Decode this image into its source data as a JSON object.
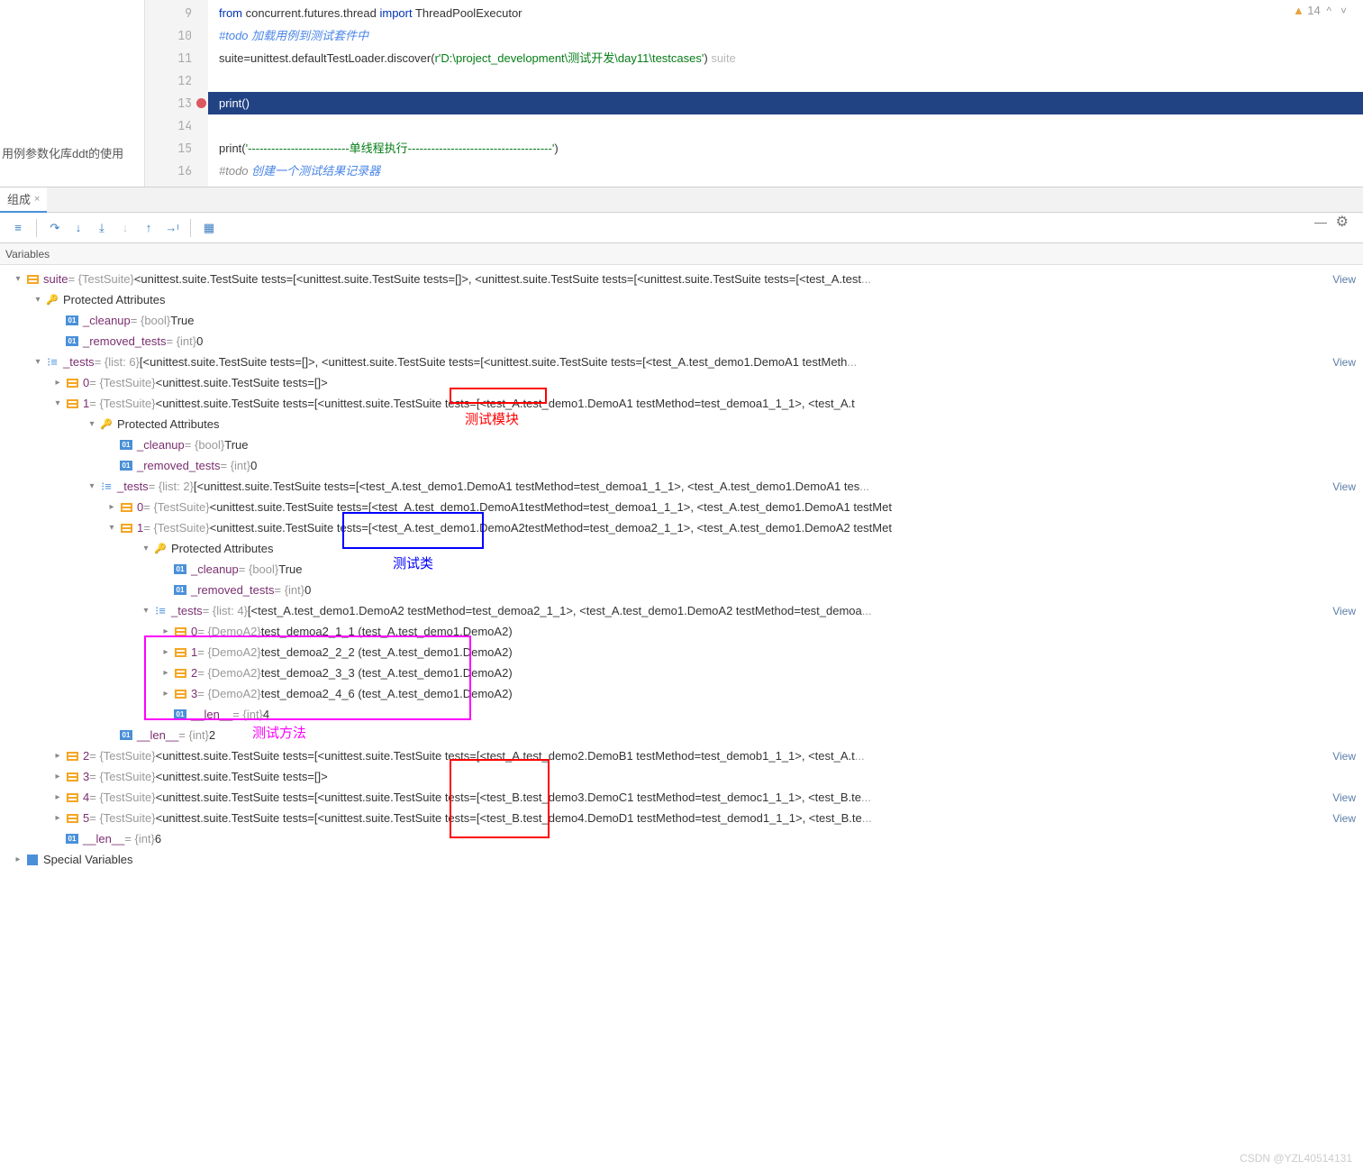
{
  "left_pane_text": "用例参数化库ddt的使用",
  "warn_count": "14",
  "lines": {
    "9": {
      "num": "9"
    },
    "10": {
      "num": "10"
    },
    "11": {
      "num": "11"
    },
    "12": {
      "num": "12"
    },
    "13": {
      "num": "13"
    },
    "14": {
      "num": "14"
    },
    "15": {
      "num": "15"
    },
    "16": {
      "num": "16"
    }
  },
  "code": {
    "l9_from": "from",
    "l9_mod": " concurrent.futures.thread ",
    "l9_import": "import",
    "l9_cls": " ThreadPoolExecutor",
    "l10": "#todo  加载用例到测试套件中",
    "l11_a": "suite=unittest.defaultTestLoader.discover(",
    "l11_b": "r'D:\\project_development\\测试开发\\day11\\testcases'",
    "l11_c": ")",
    "l11_d": "   suite",
    "l13": "print()",
    "l15_a": "print(",
    "l15_b": "'--------------------------单线程执行-------------------------------------'",
    "l15_c": ")",
    "l16_a": "#todo ",
    "l16_b": "创建一个测试结果记录器"
  },
  "tab": {
    "label": "组成",
    "close": "×"
  },
  "vars_header": "Variables",
  "tree": {
    "suite": {
      "name": "suite",
      "type": " = {TestSuite} ",
      "val": "<unittest.suite.TestSuite tests=[<unittest.suite.TestSuite tests=[]>, <unittest.suite.TestSuite tests=[<unittest.suite.TestSuite tests=[<test_A.test"
    },
    "prot": "Protected Attributes",
    "cleanup": {
      "name": "_cleanup",
      "type": " = {bool} ",
      "val": "True"
    },
    "removed": {
      "name": "_removed_tests",
      "type": " = {int} ",
      "val": "0"
    },
    "tests6": {
      "name": "_tests",
      "type": " = {list: 6} ",
      "val": "[<unittest.suite.TestSuite tests=[]>, <unittest.suite.TestSuite tests=[<unittest.suite.TestSuite tests=[<test_A.test_demo1.DemoA1 testMeth"
    },
    "t0": {
      "name": "0",
      "type": " = {TestSuite} ",
      "val": "<unittest.suite.TestSuite tests=[]>"
    },
    "t1": {
      "name": "1",
      "type": " = {TestSuite} ",
      "val": "<unittest.suite.TestSuite tests=[<unittest.suite.TestSuite tests=[",
      "mid": "<test_A.test_demo1.",
      "tail": "DemoA1 testMethod=test_demoa1_1_1>, <test_A.t"
    },
    "cleanup2": {
      "name": "_cleanup",
      "type": " = {bool} ",
      "val": "True"
    },
    "removed2": {
      "name": "_removed_tests",
      "type": " = {int} ",
      "val": "0"
    },
    "tests2": {
      "name": "_tests",
      "type": " = {list: 2} ",
      "val": "[<unittest.suite.TestSuite tests=[<test_A.test_demo1.DemoA1 testMethod=test_demoa1_1_1>, <test_A.test_demo1.DemoA1 tes"
    },
    "s0": {
      "name": "0",
      "type": " = {TestSuite} ",
      "val": "<unittest.suite.TestSuite tests=[",
      "mid": "<test_A.test_demo1.DemoA1",
      "tail": " testMethod=test_demoa1_1_1>, <test_A.test_demo1.DemoA1 testMet"
    },
    "s1": {
      "name": "1",
      "type": " = {TestSuite} ",
      "val": "<unittest.suite.TestSuite tests=[",
      "mid": "<test_A.test_demo1.DemoA2",
      "tail": " testMethod=test_demoa2_1_1>, <test_A.test_demo1.DemoA2 testMet"
    },
    "cleanup3": {
      "name": "_cleanup",
      "type": " = {bool} ",
      "val": "True"
    },
    "removed3": {
      "name": "_removed_tests",
      "type": " = {int} ",
      "val": "0"
    },
    "tests4": {
      "name": "_tests",
      "type": " = {list: 4} ",
      "val": "[<test_A.test_demo1.DemoA2 testMethod=test_demoa2_1_1>, <test_A.test_demo1.DemoA2 testMethod=test_demoa"
    },
    "m0": {
      "name": "0",
      "type": " = {DemoA2} ",
      "val": "test_demoa2_1_1 (test_A.test_demo1.DemoA2)"
    },
    "m1": {
      "name": "1",
      "type": " = {DemoA2} ",
      "val": "test_demoa2_2_2 (test_A.test_demo1.DemoA2)"
    },
    "m2": {
      "name": "2",
      "type": " = {DemoA2} ",
      "val": "test_demoa2_3_3 (test_A.test_demo1.DemoA2)"
    },
    "m3": {
      "name": "3",
      "type": " = {DemoA2} ",
      "val": "test_demoa2_4_6 (test_A.test_demo1.DemoA2)"
    },
    "len4": {
      "name": "__len__",
      "type": " = {int} ",
      "val": "4"
    },
    "len2": {
      "name": "__len__",
      "type": " = {int} ",
      "val": "2"
    },
    "t2": {
      "name": "2",
      "type": " = {TestSuite} ",
      "val": "<unittest.suite.TestSuite tests=[<unittest.suite.TestSuite tests=[",
      "mid": "<test_A.test_demo2.",
      "tail": "DemoB1 testMethod=test_demob1_1_1>, <test_A.t"
    },
    "t3": {
      "name": "3",
      "type": " = {TestSuite} ",
      "val": "<unittest.suite.TestSuite tests=[]>"
    },
    "t4": {
      "name": "4",
      "type": " = {TestSuite} ",
      "val": "<unittest.suite.TestSuite tests=[<unittest.suite.TestSuite tests=[",
      "mid": "<test_B.test_demo3.",
      "tail": "DemoC1 testMethod=test_democ1_1_1>, <test_B.te"
    },
    "t5": {
      "name": "5",
      "type": " = {TestSuite} ",
      "val": "<unittest.suite.TestSuite tests=[<unittest.suite.TestSuite tests=[",
      "mid": "<test_B.test_demo4.",
      "tail": "DemoD1 testMethod=test_demod1_1_1>, <test_B.te"
    },
    "len6": {
      "name": "__len__",
      "type": " = {int} ",
      "val": "6"
    },
    "special": "Special Variables"
  },
  "annotations": {
    "module": "测试模块",
    "class": "测试类",
    "method": "测试方法"
  },
  "view_link": "View",
  "watermark": "CSDN @YZL40514131"
}
